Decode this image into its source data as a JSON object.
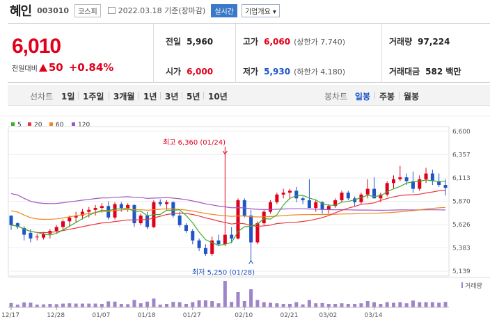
{
  "header": {
    "name": "혜인",
    "code": "003010",
    "market": "코스피",
    "date": "2022.03.18 기준(장마감)",
    "realtime": "실시간",
    "info": "기업개요 ▾"
  },
  "price": {
    "current": "6,010",
    "change_label": "전일대비",
    "change": "50",
    "change_pct": "+0.84%"
  },
  "stats": {
    "prev_label": "전일",
    "prev": "5,960",
    "open_label": "시가",
    "open": "6,000",
    "high_label": "고가",
    "high": "6,060",
    "high_limit": "(상한가 7,740)",
    "low_label": "저가",
    "low": "5,930",
    "low_limit": "(하한가 4,180)",
    "volume_label": "거래량",
    "volume": "97,224",
    "amount_label": "거래대금",
    "amount": "582 백만"
  },
  "tabs": {
    "line_label": "선차트",
    "line_items": [
      "1일",
      "1주일",
      "3개월",
      "1년",
      "3년",
      "5년",
      "10년"
    ],
    "candle_label": "봉차트",
    "candle_items": [
      "일봉",
      "주봉",
      "월봉"
    ],
    "selected_candle": "일봉"
  },
  "colors": {
    "up": "#e0001b",
    "down": "#1f55c7",
    "ma5": "#3aad2b",
    "ma20": "#e8383d",
    "ma60": "#f0861f",
    "ma120": "#9e56c4",
    "volume": "#9e85c9"
  },
  "chart_data": {
    "type": "candlestick",
    "legend": [
      "5",
      "20",
      "60",
      "120"
    ],
    "y_ticks": [
      "6,600",
      "6,357",
      "6,113",
      "5,870",
      "5,626",
      "5,383",
      "5,139"
    ],
    "ylim": [
      5139,
      6600
    ],
    "x_ticks": [
      "12/17",
      "12/28",
      "01/07",
      "01/18",
      "01/27",
      "02/10",
      "02/21",
      "03/02",
      "03/14"
    ],
    "high_annotation": "최고 6,360 (01/24)",
    "low_annotation": "최저 5,250 (01/28)",
    "volume_label": "거래량",
    "candles": [
      [
        5720,
        5700,
        5570,
        5620
      ],
      [
        5640,
        5650,
        5580,
        5600
      ],
      [
        5590,
        5610,
        5460,
        5520
      ],
      [
        5540,
        5580,
        5440,
        5480
      ],
      [
        5500,
        5530,
        5460,
        5500
      ],
      [
        5490,
        5550,
        5470,
        5530
      ],
      [
        5530,
        5580,
        5480,
        5560
      ],
      [
        5560,
        5620,
        5530,
        5600
      ],
      [
        5600,
        5680,
        5570,
        5660
      ],
      [
        5660,
        5720,
        5600,
        5700
      ],
      [
        5700,
        5760,
        5650,
        5720
      ],
      [
        5720,
        5790,
        5680,
        5760
      ],
      [
        5760,
        5810,
        5700,
        5780
      ],
      [
        5780,
        5830,
        5720,
        5800
      ],
      [
        5800,
        5850,
        5750,
        5820
      ],
      [
        5820,
        5870,
        5680,
        5700
      ],
      [
        5700,
        5860,
        5680,
        5840
      ],
      [
        5840,
        5860,
        5760,
        5800
      ],
      [
        5800,
        5850,
        5760,
        5830
      ],
      [
        5830,
        5840,
        5600,
        5640
      ],
      [
        5640,
        5740,
        5620,
        5720
      ],
      [
        5720,
        5760,
        5580,
        5600
      ],
      [
        5600,
        5880,
        5590,
        5860
      ],
      [
        5860,
        5890,
        5820,
        5840
      ],
      [
        5840,
        5880,
        5780,
        5860
      ],
      [
        5860,
        5870,
        5700,
        5720
      ],
      [
        5720,
        5760,
        5600,
        5620
      ],
      [
        5620,
        5640,
        5540,
        5560
      ],
      [
        5560,
        5580,
        5420,
        5460
      ],
      [
        5460,
        5480,
        5350,
        5380
      ],
      [
        5380,
        5420,
        5300,
        5320
      ],
      [
        5320,
        5500,
        5300,
        5460
      ],
      [
        5460,
        5520,
        5400,
        5420
      ],
      [
        5420,
        6360,
        5400,
        5520
      ],
      [
        5520,
        5600,
        5430,
        5480
      ],
      [
        5480,
        5900,
        5470,
        5880
      ],
      [
        5880,
        5900,
        5700,
        5720
      ],
      [
        5720,
        5780,
        5250,
        5440
      ],
      [
        5440,
        5660,
        5420,
        5640
      ],
      [
        5640,
        5780,
        5620,
        5760
      ],
      [
        5760,
        5880,
        5740,
        5860
      ],
      [
        5860,
        5960,
        5840,
        5940
      ],
      [
        5940,
        6000,
        5900,
        5960
      ],
      [
        5960,
        6000,
        5900,
        5980
      ],
      [
        5980,
        6020,
        5860,
        5900
      ],
      [
        5900,
        5920,
        5840,
        5880
      ],
      [
        5880,
        6100,
        5860,
        5800
      ],
      [
        5800,
        5880,
        5760,
        5860
      ],
      [
        5860,
        5870,
        5740,
        5780
      ],
      [
        5780,
        5840,
        5740,
        5820
      ],
      [
        5820,
        5900,
        5800,
        5880
      ],
      [
        5880,
        5980,
        5860,
        5960
      ],
      [
        5960,
        5980,
        5880,
        5900
      ],
      [
        5900,
        5920,
        5820,
        5860
      ],
      [
        5860,
        5960,
        5840,
        5940
      ],
      [
        5940,
        6100,
        5900,
        6000
      ],
      [
        6000,
        6120,
        5960,
        5900
      ],
      [
        5900,
        5960,
        5860,
        5940
      ],
      [
        5940,
        6080,
        5920,
        6060
      ],
      [
        6060,
        6140,
        6000,
        6100
      ],
      [
        6100,
        6240,
        6080,
        6120
      ],
      [
        6120,
        6160,
        6040,
        6080
      ],
      [
        6080,
        6180,
        5960,
        6000
      ],
      [
        6000,
        6140,
        5980,
        6100
      ],
      [
        6100,
        6220,
        6060,
        6160
      ],
      [
        6160,
        6200,
        6040,
        6080
      ],
      [
        6080,
        6160,
        6020,
        6040
      ],
      [
        6040,
        6100,
        5930,
        6010
      ]
    ]
  }
}
